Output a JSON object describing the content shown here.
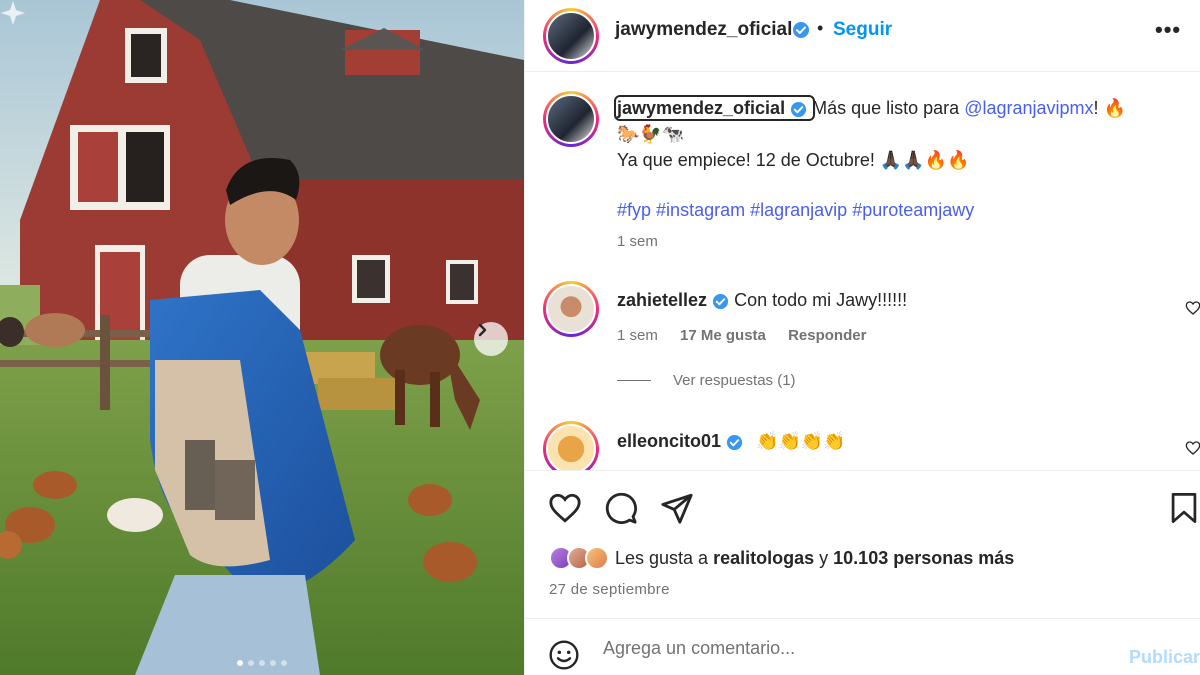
{
  "post": {
    "author": "jawymendez_oficial",
    "follow_label": "Seguir",
    "bullet": "•",
    "more_label": "•••",
    "caption_mention": "@lagranjavipmx",
    "caption_line1": "Más que listo para",
    "caption_line1_end": "! 🔥",
    "caption_line2": "🐎🐓🐄",
    "caption_line3": "Ya que empiece! 12 de Octubre! 🙏🏿🙏🏿🔥🔥",
    "hashtags": [
      "#fyp",
      "#instagram",
      "#lagranjavip",
      "#puroteamjawy"
    ],
    "caption_time": "1 sem"
  },
  "comments": [
    {
      "user": "zahietellez",
      "text": "Con todo mi Jawy!!!!!!",
      "time": "1 sem",
      "likes": "17 Me gusta",
      "reply": "Responder",
      "replies": "Ver respuestas (1)"
    },
    {
      "user": "elleoncito01",
      "text": "👏👏👏👏"
    }
  ],
  "likes": {
    "prefix": "Les gusta a",
    "user": "realitologas",
    "middle": "y",
    "count": "10.103 personas más"
  },
  "date": "27 de septiembre",
  "composer": {
    "placeholder": "Agrega un comentario...",
    "publish": "Publicar"
  },
  "carousel": {
    "slides": 5,
    "active": 1
  },
  "colors": {
    "accent": "#0095f6",
    "hashtag": "#4a5ef0",
    "verified": "#3897f0",
    "muted": "#737373",
    "publish_disabled": "#b3dbff"
  },
  "icons": [
    "chevron-right-icon",
    "verified-icon",
    "more-icon",
    "heart-icon",
    "comment-icon",
    "share-icon",
    "bookmark-icon",
    "emoji-icon",
    "sparkle-icon"
  ]
}
